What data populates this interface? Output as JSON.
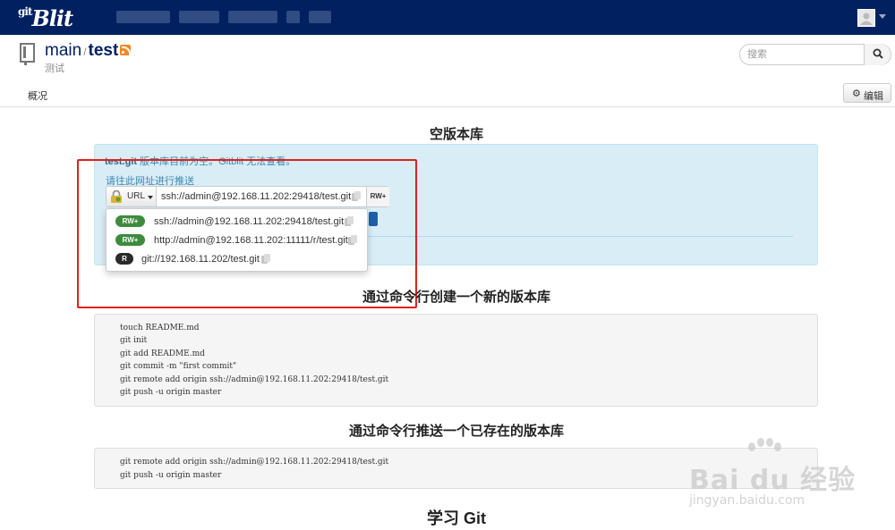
{
  "navbar": {
    "logo_prefix": "git",
    "logo_main": "Blit"
  },
  "repo": {
    "project": "main",
    "separator": "/",
    "name": "test",
    "description": "测试"
  },
  "search": {
    "placeholder": "搜索"
  },
  "subnav": {
    "overview_tab": "概况",
    "edit_label": "编辑"
  },
  "empty_heading": "空版本库",
  "alert": {
    "repo_name": "test.git",
    "message": " 版本库目前为空。Gitblit 无法查看。",
    "push_prompt": "请往此网址进行推送"
  },
  "urlbar": {
    "toggle_label": "URL",
    "current_url": "ssh://admin@192.168.11.202:29418/test.git",
    "permission": "RW+"
  },
  "dropdown": {
    "items": [
      {
        "badge": "RW+",
        "url": "ssh://admin@192.168.11.202:29418/test.git"
      },
      {
        "badge": "RW+",
        "url": "http://admin@192.168.11.202:11111/r/test.git"
      },
      {
        "badge": "R",
        "url": "git://192.168.11.202/test.git"
      }
    ]
  },
  "section_new": {
    "heading": "通过命令行创建一个新的版本库",
    "lines": [
      "touch README.md",
      "git init",
      "git add README.md",
      "git commit -m \"first commit\"",
      "git remote add origin ssh://admin@192.168.11.202:29418/test.git",
      "git push -u origin master"
    ]
  },
  "section_existing": {
    "heading": "通过命令行推送一个已存在的版本库",
    "lines": [
      "git remote add origin ssh://admin@192.168.11.202:29418/test.git",
      "git push -u origin master"
    ]
  },
  "learn_heading": "学习 Git",
  "watermark": {
    "brand": "Bai du 经验",
    "url": "jingyan.baidu.com"
  },
  "colors": {
    "navbar": "#002060",
    "alert_bg": "#d9edf7",
    "badge_rw": "#3d8b3d",
    "badge_r": "#2a2a2a",
    "annotation": "#e02020"
  }
}
